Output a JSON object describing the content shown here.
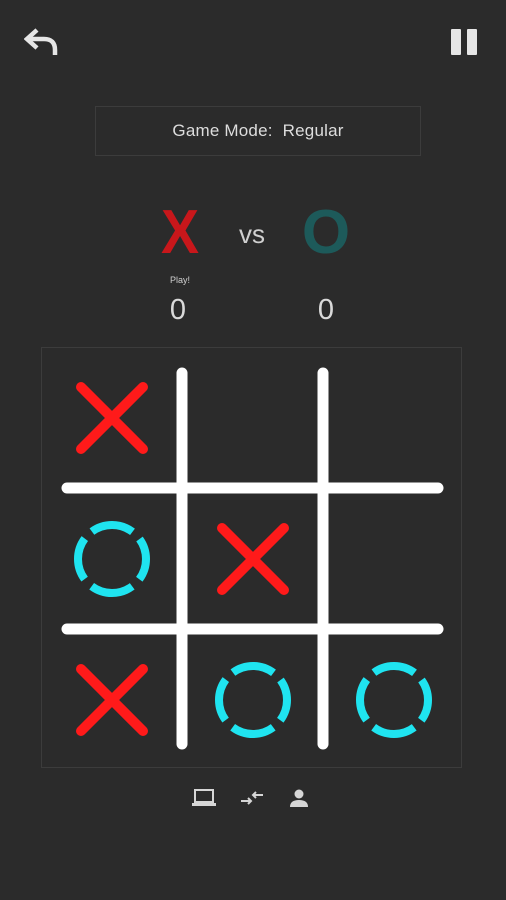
{
  "top_bar": {
    "back_icon": "undo-arrow-icon",
    "pause_icon": "pause-icon"
  },
  "game_mode": {
    "label": "Game Mode:",
    "value": "Regular"
  },
  "versus": {
    "player_x_symbol": "X",
    "vs_label": "vs",
    "player_o_symbol": "O",
    "turn_label": "Play!",
    "score_x": "0",
    "score_o": "0"
  },
  "board": {
    "cells": [
      [
        "X",
        "",
        ""
      ],
      [
        "O",
        "X",
        ""
      ],
      [
        "X",
        "O",
        "O"
      ]
    ]
  },
  "bottom_bar": {
    "icons": [
      "computer-icon",
      "swap-arrows-icon",
      "person-icon"
    ]
  },
  "colors": {
    "background": "#2b2b2b",
    "x_mark": "#ff1a1a",
    "o_mark": "#1fe4f0",
    "grid": "#ffffff",
    "x_header": "#c8171b",
    "o_header": "#1d5a5a"
  }
}
